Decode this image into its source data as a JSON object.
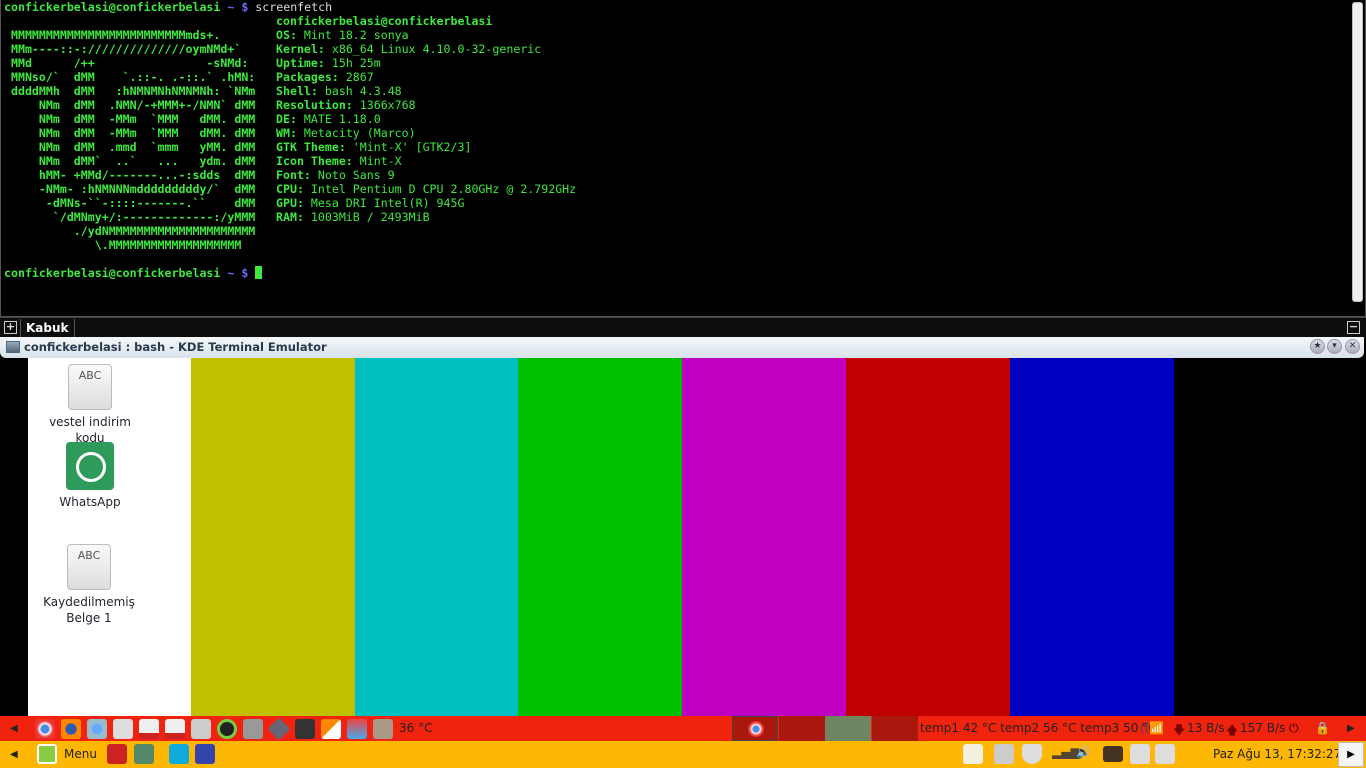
{
  "terminal": {
    "user": "confickerbelasi@confickerbelasi",
    "prompt_sym": " ~ $ ",
    "command": "screenfetch",
    "logo": [
      " MMMMMMMMMMMMMMMMMMMMMMMMMmds+.",
      " MMm----::-://////////////oymNMd+`",
      " MMd      /++                -sNMd:",
      " MMNso/`  dMM    `.::-. .-::.` .hMN:",
      " ddddMMh  dMM   :hNMNMNhNMNMNh: `NMm",
      "     NMm  dMM  .NMN/-+MMM+-/NMN` dMM",
      "     NMm  dMM  -MMm  `MMM   dMM. dMM",
      "     NMm  dMM  -MMm  `MMM   dMM. dMM",
      "     NMm  dMM  .mmd  `mmm   yMM. dMM",
      "     NMm  dMM`  ..`   ...   ydm. dMM",
      "     hMM- +MMd/-------...-:sdds  dMM",
      "     -NMm- :hNMNNNmdddddddddy/`  dMM",
      "      -dMNs-``-::::-------.``    dMM",
      "       `/dMNmy+/:-------------:/yMMM",
      "          ./ydNMMMMMMMMMMMMMMMMMMMMM",
      "             \\.MMMMMMMMMMMMMMMMMMM"
    ],
    "host": "confickerbelasi@confickerbelasi",
    "info": [
      {
        "k": "OS:",
        "v": " Mint 18.2 sonya"
      },
      {
        "k": "Kernel:",
        "v": " x86_64 Linux 4.10.0-32-generic"
      },
      {
        "k": "Uptime:",
        "v": " 15h 25m"
      },
      {
        "k": "Packages:",
        "v": " 2867"
      },
      {
        "k": "Shell:",
        "v": " bash 4.3.48"
      },
      {
        "k": "Resolution:",
        "v": " 1366x768"
      },
      {
        "k": "DE:",
        "v": " MATE 1.18.0"
      },
      {
        "k": "WM:",
        "v": " Metacity (Marco)"
      },
      {
        "k": "GTK Theme:",
        "v": " 'Mint-X' [GTK2/3]"
      },
      {
        "k": "Icon Theme:",
        "v": " Mint-X"
      },
      {
        "k": "Font:",
        "v": " Noto Sans 9"
      },
      {
        "k": "CPU:",
        "v": " Intel Pentium D CPU 2.80GHz @ 2.792GHz"
      },
      {
        "k": "GPU:",
        "v": " Mesa DRI Intel(R) 945G"
      },
      {
        "k": "RAM:",
        "v": " 1003MiB / 2493MiB"
      }
    ],
    "tab": "Kabuk",
    "title": "confickerbelasi : bash - KDE Terminal Emulator"
  },
  "desktop": {
    "icons": [
      {
        "label": "vestel indirim kodu",
        "glyph": "ABC"
      },
      {
        "label": "WhatsApp"
      },
      {
        "label": "Kaydedilmemiş Belge 1",
        "glyph": "ABC"
      }
    ],
    "bars": [
      "#c0c000",
      "#00c0c0",
      "#00c000",
      "#c000c0",
      "#c00000",
      "#0000c0"
    ]
  },
  "panel_top": {
    "cpu_temp": "36 °C",
    "temps": "temp1 42 °C temp2 56 °C temp3 50 °C",
    "down": "13 B/s",
    "up": "157 B/s"
  },
  "panel_bottom": {
    "menu": "Menu",
    "clock": "Paz Ağu 13, 17:32:27"
  }
}
